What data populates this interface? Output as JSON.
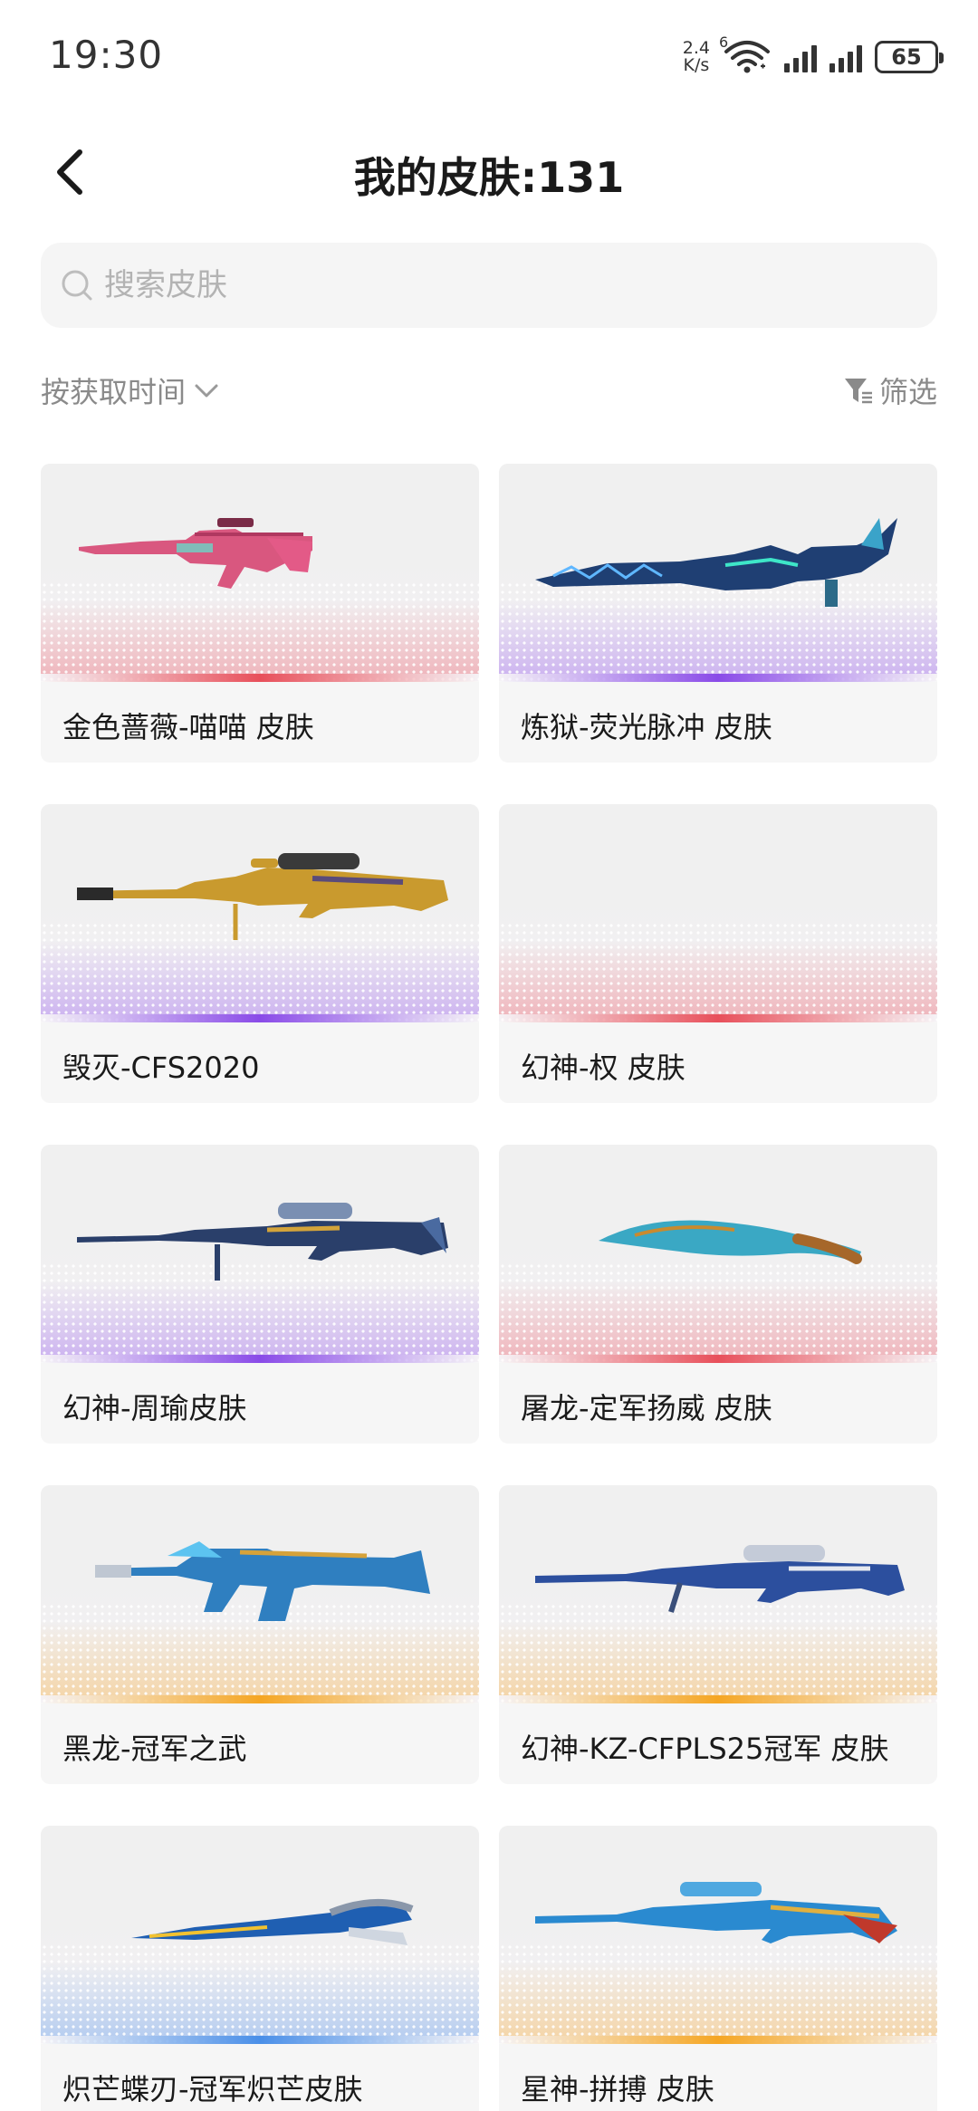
{
  "status_bar": {
    "time": "19:30",
    "net_speed_value": "2.4",
    "net_speed_unit": "K/s",
    "wifi_badge": "6",
    "battery": "65"
  },
  "header": {
    "title": "我的皮肤:131"
  },
  "search": {
    "placeholder": "搜索皮肤",
    "value": ""
  },
  "toolbar": {
    "sort_label": "按获取时间",
    "filter_label": "筛选"
  },
  "skins": [
    {
      "name": "金色蔷薇-喵喵 皮肤",
      "rarity_color": "#e8505b",
      "weapon": "rifle-pink"
    },
    {
      "name": "炼狱-荧光脉冲 皮肤",
      "rarity_color": "#8a4be8",
      "weapon": "dragon-blade"
    },
    {
      "name": "毁灭-CFS2020",
      "rarity_color": "#8a4be8",
      "weapon": "sniper-gold"
    },
    {
      "name": "幻神-权 皮肤",
      "rarity_color": "#e8505b",
      "weapon": "empty"
    },
    {
      "name": "幻神-周瑜皮肤",
      "rarity_color": "#8a4be8",
      "weapon": "sniper-blue"
    },
    {
      "name": "屠龙-定军扬威 皮肤",
      "rarity_color": "#e8505b",
      "weapon": "kukri"
    },
    {
      "name": "黑龙-冠军之武",
      "rarity_color": "#f5a623",
      "weapon": "m4-blue"
    },
    {
      "name": "幻神-KZ-CFPLS25冠军 皮肤",
      "rarity_color": "#f5a623",
      "weapon": "sniper-kz"
    },
    {
      "name": "炽芒蝶刃-冠军炽芒皮肤",
      "rarity_color": "#4a8fe8",
      "weapon": "butterfly-knife"
    },
    {
      "name": "星神-拼搏 皮肤",
      "rarity_color": "#f5a623",
      "weapon": "rifle-star"
    }
  ]
}
